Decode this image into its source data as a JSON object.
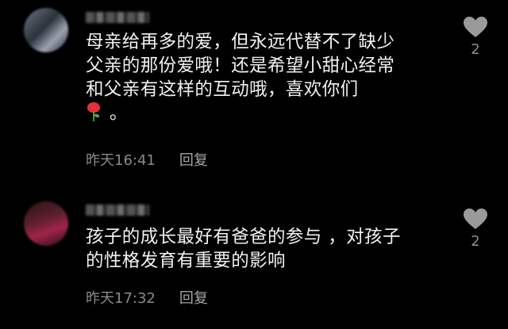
{
  "comments": [
    {
      "lines": [
        "母亲给再多的爱，但永远代替不了缺少",
        "父亲的那份爱哦！还是希望小甜心经常",
        "和父亲有这样的互动哦，喜欢你们"
      ],
      "tail": "。",
      "emoji_icon": "rose-icon",
      "time": "昨天16:41",
      "reply_label": "回复",
      "likes": "2"
    },
    {
      "lines": [
        "孩子的成长最好有爸爸的参与 ，对孩子",
        "的性格发育有重要的影响"
      ],
      "time": "昨天17:32",
      "reply_label": "回复",
      "likes": "2"
    }
  ],
  "colors": {
    "background": "#000000",
    "text": "#f2f2f2",
    "meta": "#8a8a8a",
    "icon": "#9a9a9a",
    "rose": "#e2303a"
  }
}
